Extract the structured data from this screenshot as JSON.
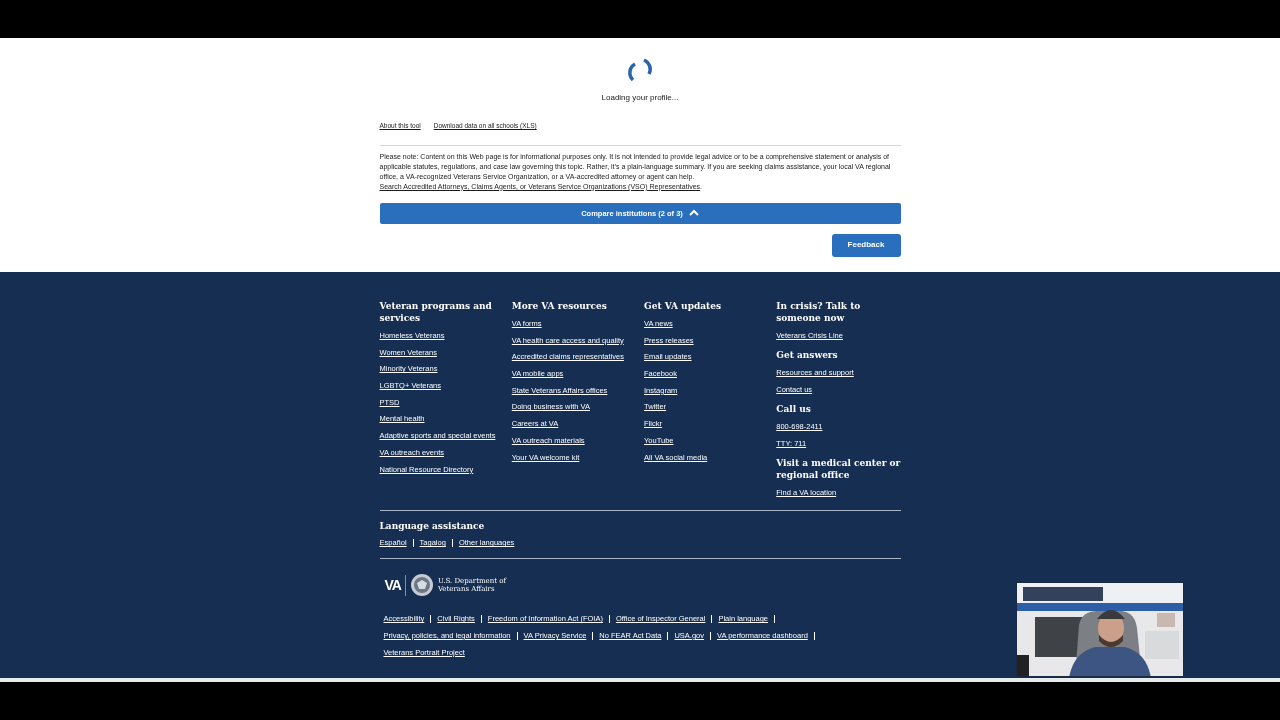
{
  "loading": {
    "text": "Loading your profile..."
  },
  "tool_links": [
    "About this tool",
    "Download data on all schools (XLS)"
  ],
  "disclaimer": {
    "text": "Please note: Content on this Web page is for informational purposes only. It is not intended to provide legal advice or to be a comprehensive statement or analysis of applicable statutes, regulations, and case law governing this topic. Rather, it’s a plain-language summary. If you are seeking claims assistance, your local VA regional office, a VA-recognized Veterans Service Organization, or a VA-accredited attorney or agent can help.",
    "link": "Search Accredited Attorneys, Claims Agents, or Veterans Service Organizations (VSO) Representatives",
    "end": "."
  },
  "compare_bar": {
    "label": "Compare institutions (2 of 3)",
    "expanded": true
  },
  "feedback_button": "Feedback",
  "footer_columns": [
    {
      "sections": [
        {
          "heading": "Veteran programs and services",
          "links": [
            "Homeless Veterans",
            "Women Veterans",
            "Minority Veterans",
            "LGBTQ+ Veterans",
            "PTSD",
            "Mental health",
            "Adaptive sports and special events",
            "VA outreach events",
            "National Resource Directory"
          ]
        }
      ]
    },
    {
      "sections": [
        {
          "heading": "More VA resources",
          "links": [
            "VA forms",
            "VA health care access and quality",
            "Accredited claims representatives",
            "VA mobile apps",
            "State Veterans Affairs offices",
            "Doing business with VA",
            "Careers at VA",
            "VA outreach materials",
            "Your VA welcome kit"
          ]
        }
      ]
    },
    {
      "sections": [
        {
          "heading": "Get VA updates",
          "links": [
            "VA news",
            "Press releases",
            "Email updates",
            "Facebook",
            "Instagram",
            "Twitter",
            "Flickr",
            "YouTube",
            "All VA social media"
          ]
        }
      ]
    },
    {
      "sections": [
        {
          "heading": "In crisis? Talk to someone now",
          "links": [
            "Veterans Crisis Line"
          ]
        },
        {
          "heading": "Get answers",
          "links": [
            "Resources and support",
            "Contact us"
          ]
        },
        {
          "heading": "Call us",
          "links": [
            "800-698-2411",
            "TTY: 711"
          ]
        },
        {
          "heading": "Visit a medical center or regional office",
          "links": [
            "Find a VA location"
          ]
        }
      ]
    }
  ],
  "language_assistance": {
    "heading": "Language assistance",
    "links": [
      "Español",
      "Tagalog",
      "Other languages"
    ]
  },
  "logo": {
    "mark": "VA",
    "department": "U.S. Department of Veterans Affairs"
  },
  "bottom_links": [
    [
      "Accessibility",
      "Civil Rights",
      "Freedom of Information Act (FOIA)",
      "Office of Inspector General",
      "Plain language"
    ],
    [
      "Privacy, policies, and legal information",
      "VA Privacy Service",
      "No FEAR Act Data",
      "USA.gov",
      "VA performance dashboard"
    ],
    [
      "Veterans Portrait Project"
    ]
  ],
  "webcam": {
    "kind": "picture"
  }
}
